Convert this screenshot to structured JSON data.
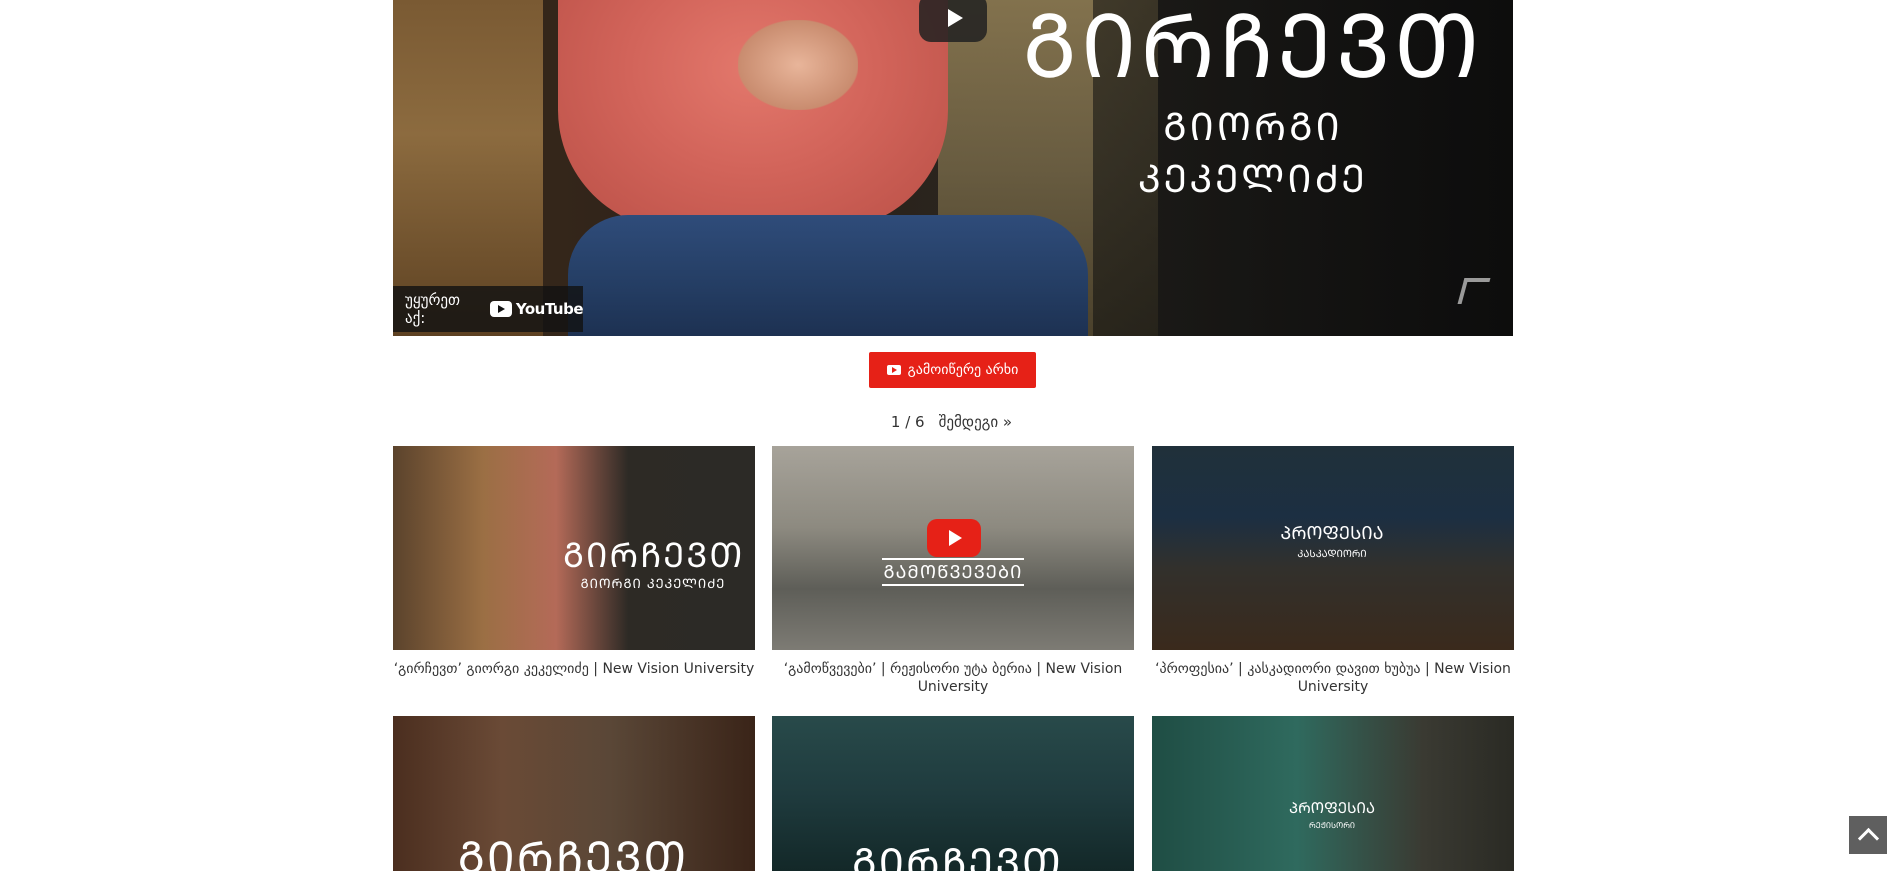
{
  "player": {
    "overlay_title": "ᲒᲘᲠᲩᲔᲕᲗ",
    "overlay_subtitle": "ᲒᲘᲝᲠᲒᲘ ᲙᲔᲙᲔᲚᲘᲫᲔ",
    "watch_on_label": "უყურეთ აქ:",
    "youtube_label": "YouTube"
  },
  "subscribe": {
    "label": "გამოიწერე არხი"
  },
  "pagination": {
    "position": "1 / 6",
    "next_label": "შემდეგი »"
  },
  "videos": [
    {
      "title": "‘გირჩევთ’ გიორგი კეკელიძე | New Vision University",
      "thumb_title": "ᲒᲘᲠᲩᲔᲕᲗ",
      "thumb_subtitle": "ᲒᲘᲝᲠᲒᲘ ᲙᲔᲙᲔᲚᲘᲫᲔ"
    },
    {
      "title": "‘გამოწვევები’ | რეჟისორი უტა ბერია | New Vision University",
      "thumb_title": "ᲒᲐᲛᲝᲬᲕᲔᲕᲔᲑᲘ"
    },
    {
      "title": "‘პროფესია’ | კასკადიორი დავით ხუბუა | New Vision University",
      "thumb_title": "ᲞᲠᲝᲤᲔᲡᲘᲐ",
      "thumb_subtitle": "ᲙᲐᲡᲙᲐᲓᲘᲝᲠᲘ"
    },
    {
      "thumb_title": "ᲒᲘᲠᲩᲔᲕᲗ"
    },
    {
      "thumb_title": "ᲒᲘᲠᲩᲔᲕᲗ"
    },
    {
      "thumb_title": "ᲞᲠᲝᲤᲔᲡᲘᲐ",
      "thumb_subtitle": "ᲠᲔᲟᲘᲡᲝᲠᲘ"
    }
  ],
  "icons": {
    "play": "play-icon",
    "youtube": "youtube-icon",
    "scroll_top": "chevron-up-icon"
  },
  "colors": {
    "subscribe_bg": "#e62117",
    "scroll_top_bg": "#5f5f5f"
  }
}
